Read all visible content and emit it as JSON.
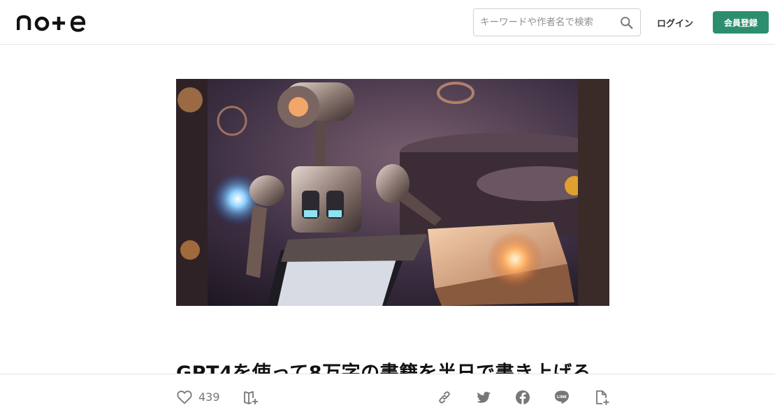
{
  "header": {
    "logo_text": "note",
    "search": {
      "placeholder": "キーワードや作者名で検索",
      "value": ""
    },
    "login_label": "ログイン",
    "signup_label": "会員登録",
    "accent_color": "#2c8e6e"
  },
  "article": {
    "title": "GPT4を使って8万字の書籍を半日で書き上げる",
    "hero_image": "robot-typing-at-laptop-illustration"
  },
  "actions": {
    "like_count": "439",
    "icons": [
      "heart-icon",
      "magazine-add-icon",
      "link-icon",
      "twitter-icon",
      "facebook-icon",
      "line-icon",
      "note-add-icon"
    ]
  }
}
